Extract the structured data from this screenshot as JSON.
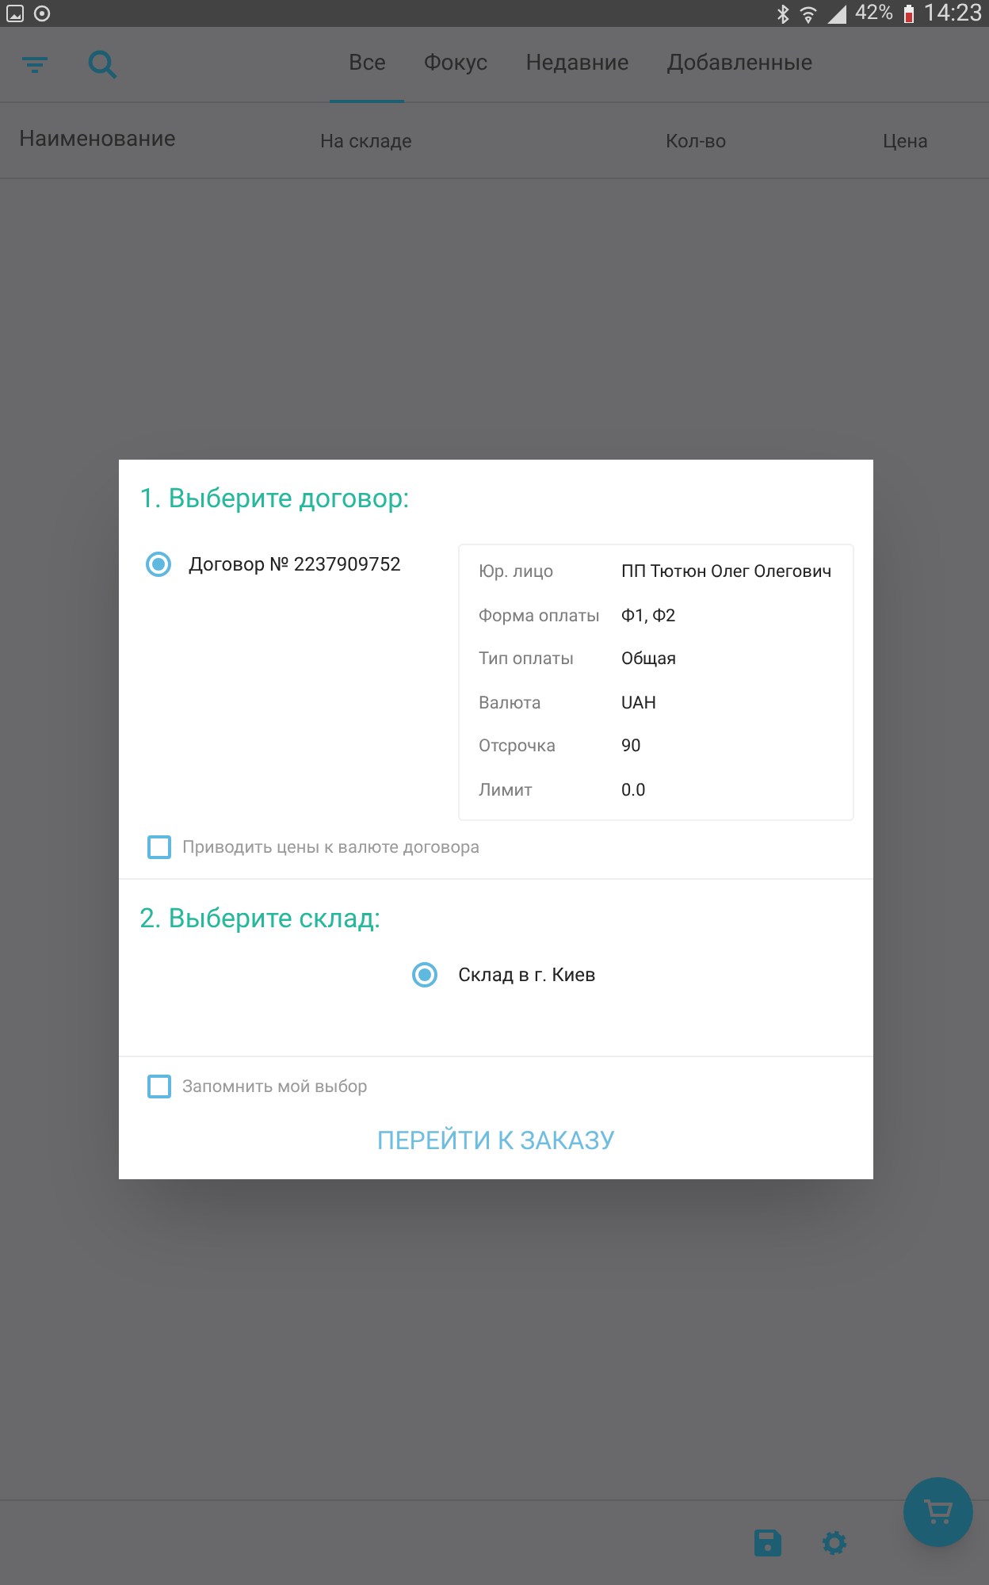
{
  "status_bar": {
    "battery": "42%",
    "time": "14:23"
  },
  "tabs": [
    {
      "label": "Все",
      "selected": true
    },
    {
      "label": "Фокус",
      "selected": false
    },
    {
      "label": "Недавние",
      "selected": false
    },
    {
      "label": "Добавленные",
      "selected": false
    }
  ],
  "table": {
    "columns": [
      "Наименование",
      "На складе",
      "Кол-во",
      "Цена"
    ]
  },
  "dialog": {
    "contract_title": "1. Выберите договор:",
    "contracts": [
      {
        "label": "Договор № 2237909752",
        "selected": true
      }
    ],
    "details": [
      {
        "label": "Юр. лицо",
        "value": "ПП Тютюн Олег Олегович"
      },
      {
        "label": "Форма оплаты",
        "value": "Ф1, Ф2"
      },
      {
        "label": "Тип оплаты",
        "value": "Общая"
      },
      {
        "label": "Валюта",
        "value": "UAH"
      },
      {
        "label": "Отсрочка",
        "value": "90"
      },
      {
        "label": "Лимит",
        "value": "0.0"
      }
    ],
    "convert_prices": {
      "label": "Приводить цены к валюте договора",
      "checked": false
    },
    "warehouse_title": "2. Выберите склад:",
    "warehouses": [
      {
        "label": "Склад в г. Киев",
        "selected": true
      }
    ],
    "remember": {
      "label": "Запомнить мой выбор",
      "checked": false
    },
    "button": "ПЕРЕЙТИ К ЗАКАЗУ"
  }
}
